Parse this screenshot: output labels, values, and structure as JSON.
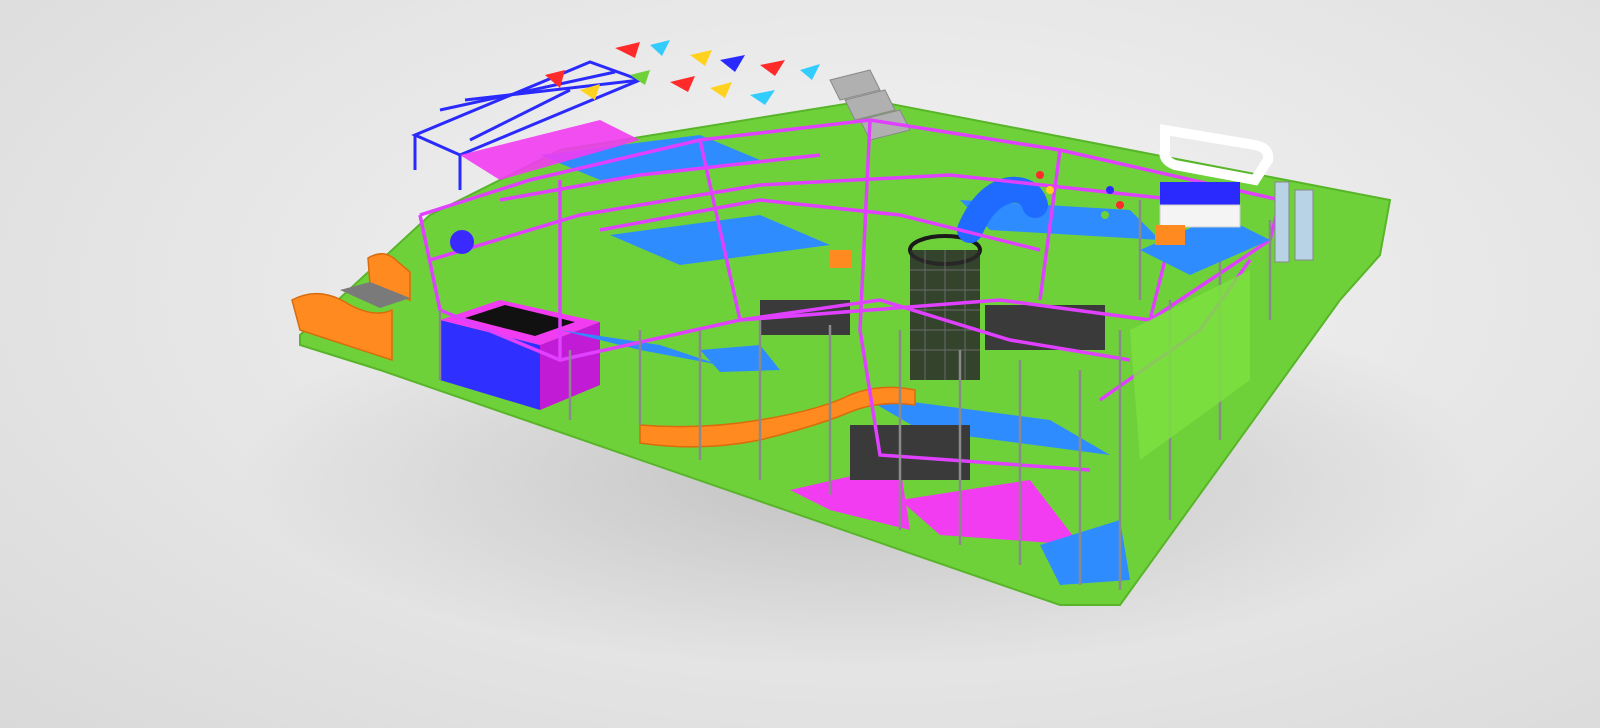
{
  "scene": {
    "subject": "indoor-playground-render",
    "colors": {
      "background": "#e4e4e4",
      "floor": "#6fd13a",
      "frame_magenta": "#e040ff",
      "frame_blue": "#2a2aff",
      "frame_gray": "#8a8a8a",
      "platform_blue": "#2f8cff",
      "pad_magenta": "#f23cf2",
      "slide_orange": "#ff8a1f",
      "tube_blue": "#1f6bff",
      "net_black": "#1a1a1a",
      "white_frame": "#ffffff"
    }
  }
}
